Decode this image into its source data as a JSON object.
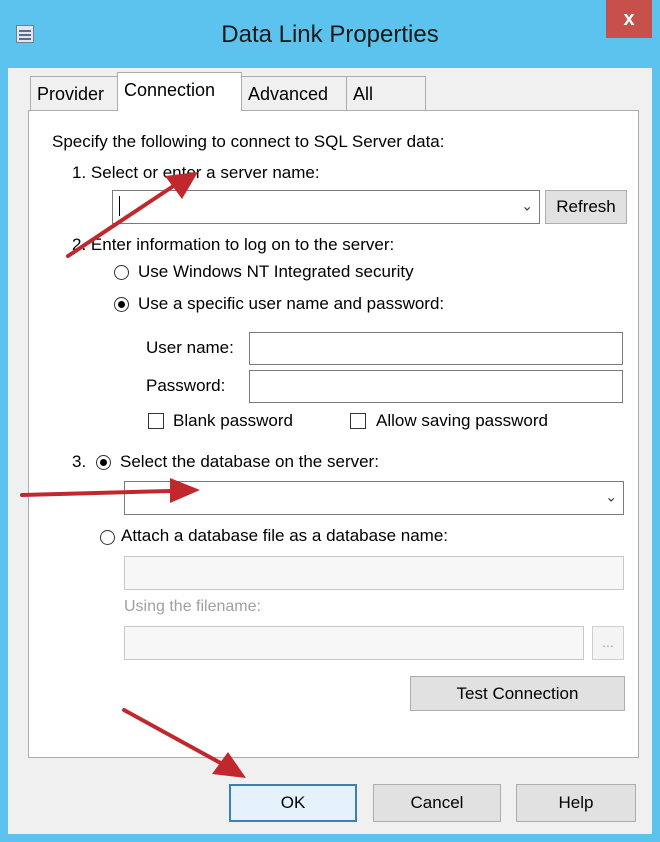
{
  "window": {
    "title": "Data Link Properties",
    "close_glyph": "x"
  },
  "tabs": [
    {
      "label": "Provider"
    },
    {
      "label": "Connection"
    },
    {
      "label": "Advanced"
    },
    {
      "label": "All"
    }
  ],
  "connection": {
    "intro": "Specify the following to connect to SQL Server data:",
    "step1_label": "1. Select or enter a server name:",
    "server_name_value": "",
    "refresh_label": "Refresh",
    "step2_label": "2. Enter information to log on to the server:",
    "radio_nt_security": "Use Windows NT Integrated security",
    "radio_specific_user": "Use a specific user name and password:",
    "username_label": "User name:",
    "username_value": "",
    "password_label": "Password:",
    "password_value": "",
    "blank_password_label": "Blank password",
    "allow_saving_label": "Allow saving password",
    "step3_prefix": "3.",
    "radio_select_db": "Select the database on the server:",
    "database_value": "",
    "radio_attach_db": "Attach a database file as a database name:",
    "attach_name_value": "",
    "using_filename_label": "Using the filename:",
    "filename_value": "",
    "browse_label": "...",
    "test_connection_label": "Test Connection"
  },
  "footer": {
    "ok_label": "OK",
    "cancel_label": "Cancel",
    "help_label": "Help"
  },
  "colors": {
    "title_bar": "#5cc3ee",
    "close_button": "#c7514a",
    "annotation_arrow": "#c0282d"
  }
}
